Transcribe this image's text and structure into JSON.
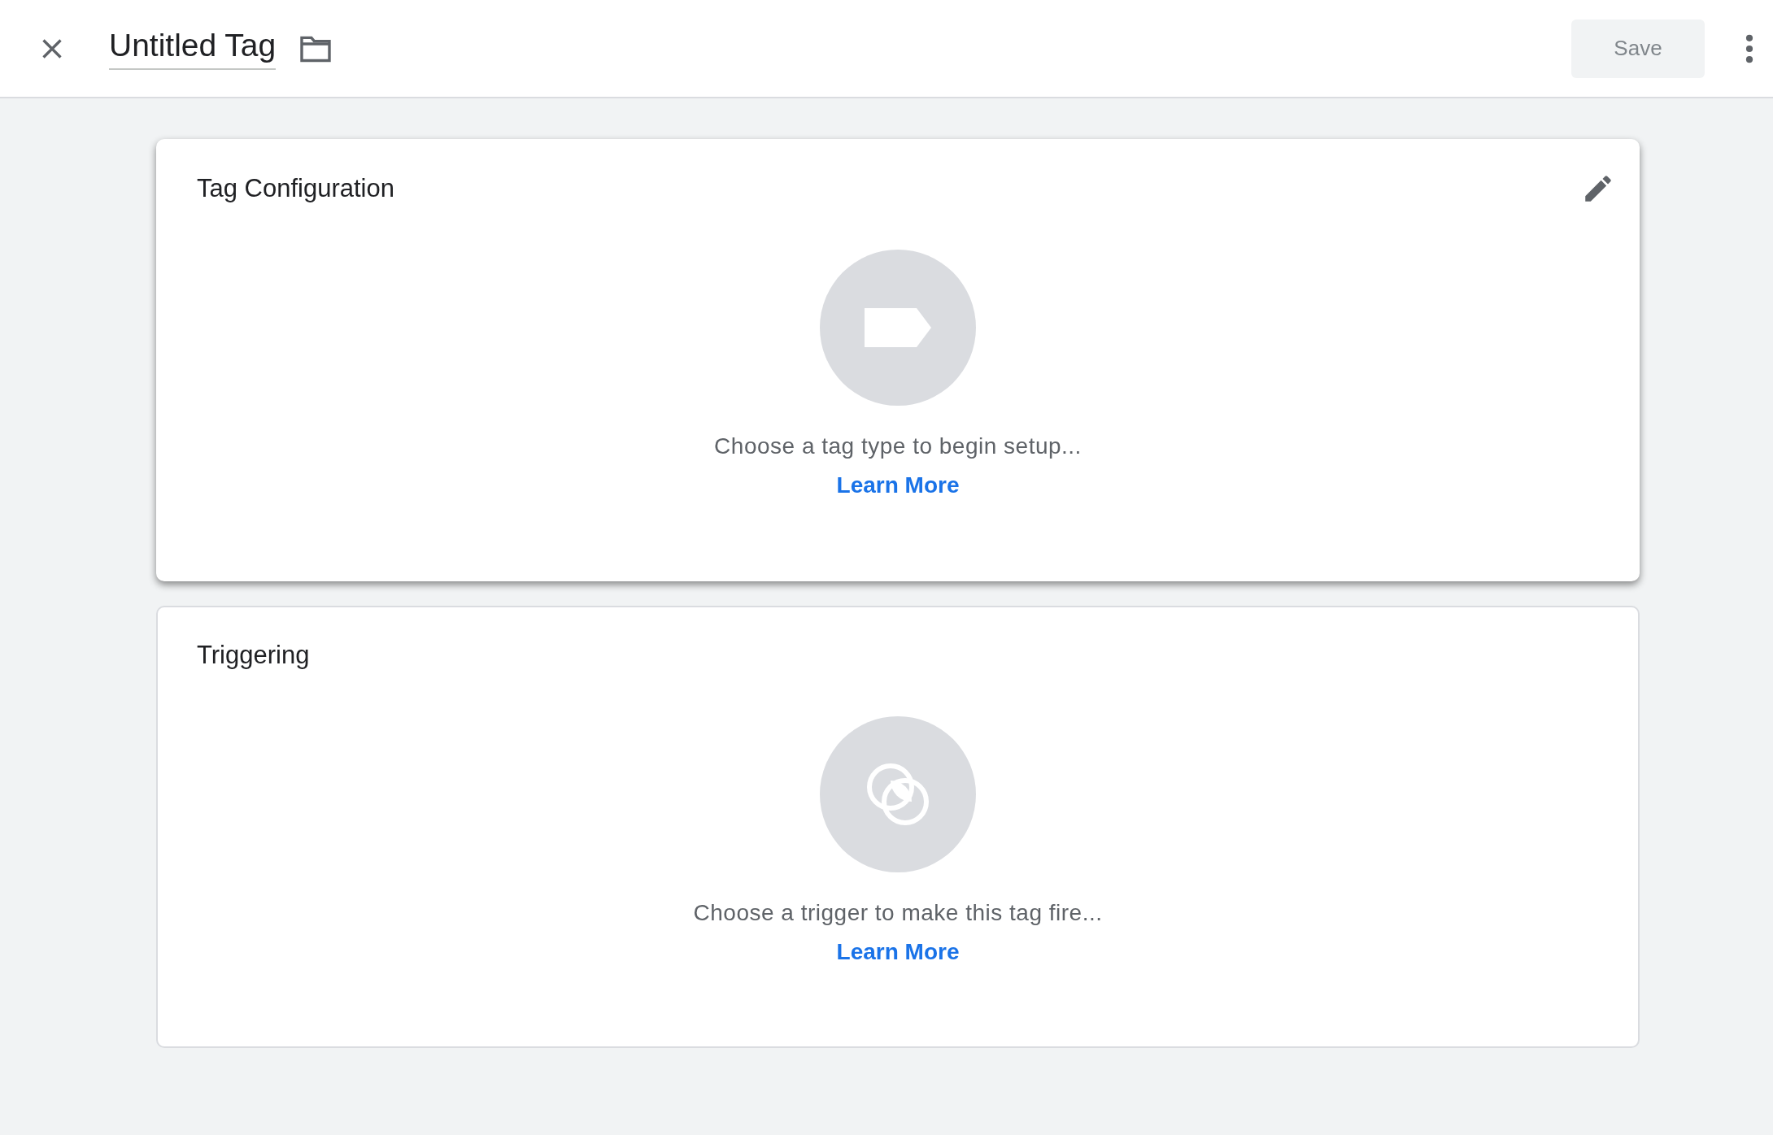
{
  "header": {
    "title": "Untitled Tag",
    "save_button": {
      "label": "Save",
      "disabled": true
    }
  },
  "cards": [
    {
      "kind": "tag",
      "title": "Tag Configuration",
      "editable": true,
      "raised": true,
      "prompt": "Choose a tag type to begin setup...",
      "link": "Learn More"
    },
    {
      "kind": "trigger",
      "title": "Triggering",
      "editable": false,
      "raised": false,
      "prompt": "Choose a trigger to make this tag fire...",
      "link": "Learn More"
    }
  ]
}
